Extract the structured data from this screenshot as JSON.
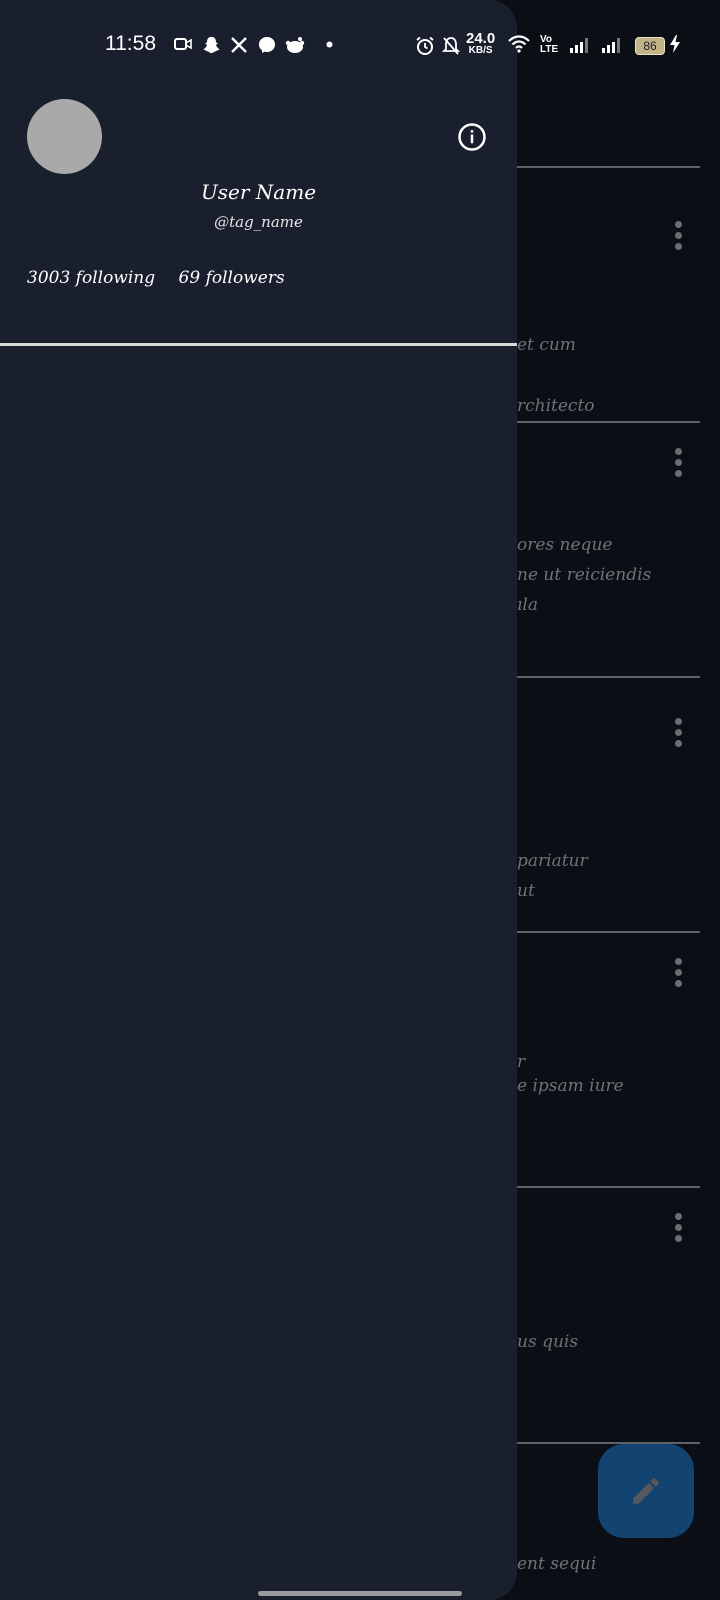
{
  "status_bar": {
    "time": "11:58",
    "net_speed_value": "24.0",
    "net_speed_unit": "KB/S",
    "volte": "Vo\nLTE",
    "battery": "86",
    "icons": [
      "video-call-icon",
      "snapchat-icon",
      "x-icon",
      "messenger-icon",
      "reddit-icon",
      "dot-icon",
      "alarm-icon",
      "bell-off-icon",
      "wifi-icon",
      "volte-icon",
      "signal-icon",
      "signal-icon",
      "battery-icon",
      "charging-icon"
    ]
  },
  "drawer": {
    "user_name": "User Name",
    "tag_name": "@tag_name",
    "following": "3003 following",
    "followers": "69 followers",
    "info_icon": "info-icon"
  },
  "feed": {
    "posts": [
      {
        "lines": [
          "et cum",
          "rchitecto"
        ]
      },
      {
        "lines": [
          "ores neque",
          "ne ut reiciendis",
          "ıla"
        ]
      },
      {
        "lines": [
          "pariatur",
          "ut"
        ]
      },
      {
        "lines": [
          "r",
          "e ipsam iure"
        ]
      },
      {
        "lines": [
          "us quis"
        ]
      },
      {
        "lines": [
          "ent sequi"
        ]
      }
    ]
  },
  "fab": {
    "icon": "edit-icon"
  },
  "colors": {
    "drawer_bg": "#1a1f2e",
    "feed_bg": "#0b0e14",
    "fab_bg": "#134471",
    "avatar": "#a9a9a9"
  }
}
